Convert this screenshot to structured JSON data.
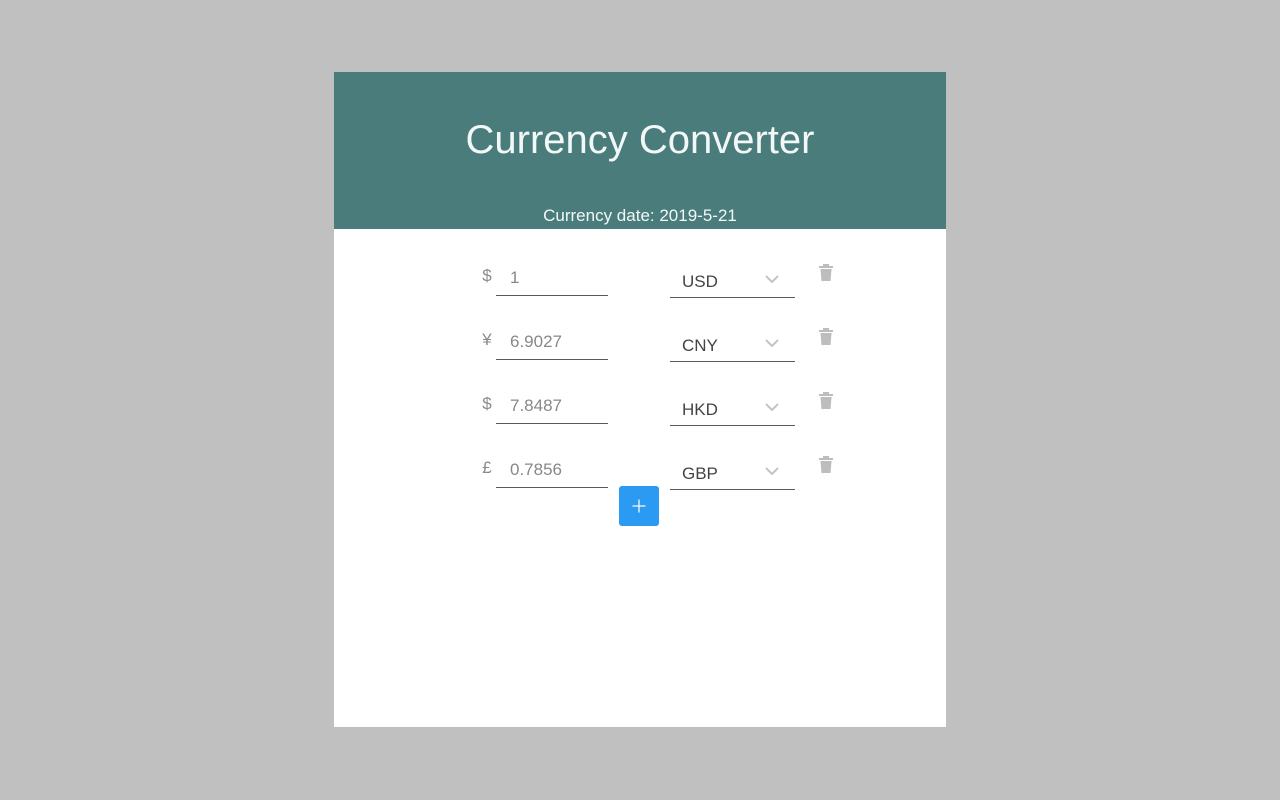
{
  "header": {
    "title": "Currency Converter",
    "date_text": "Currency date: 2019-5-21"
  },
  "colors": {
    "header_bg": "#4a7c7c",
    "accent": "#2b9af3",
    "page_bg": "#c0c0c0"
  },
  "rows": [
    {
      "symbol": "$",
      "amount": "1",
      "currency": "USD"
    },
    {
      "symbol": "¥",
      "amount": "6.9027",
      "currency": "CNY"
    },
    {
      "symbol": "$",
      "amount": "7.8487",
      "currency": "HKD"
    },
    {
      "symbol": "£",
      "amount": "0.7856",
      "currency": "GBP"
    }
  ],
  "icons": {
    "dropdown": "chevron-down-icon",
    "delete": "trash-icon",
    "add": "plus-icon"
  }
}
